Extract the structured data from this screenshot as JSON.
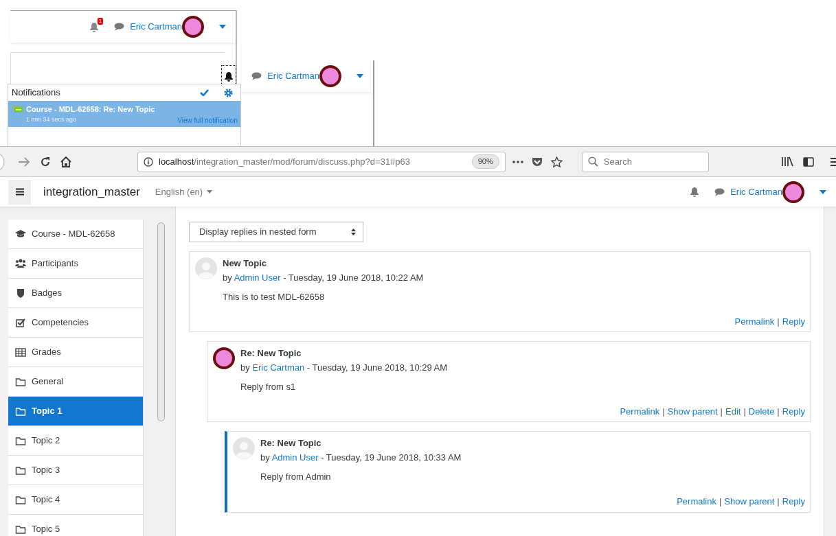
{
  "header_snippet": {
    "notification_count": "1",
    "user_name": "Eric Cartman"
  },
  "header_snippet_focused": {
    "user_name": "Eric Cartman",
    "bell_focused": true
  },
  "notifications_popover": {
    "title": "Notifications",
    "items": [
      {
        "title": "Course - MDL-62658: Re: New Topic",
        "time": "1 min 34 secs ago",
        "link": "View full notification",
        "selected": true
      }
    ]
  },
  "browser": {
    "url_host": "localhost",
    "url_path": "/integration_master/mod/forum/discuss.php?d=31#p63",
    "zoom": "90%",
    "search_placeholder": "Search"
  },
  "navbar": {
    "site_name": "integration_master",
    "language": "English (en)",
    "user_name": "Eric Cartman"
  },
  "drawer": {
    "items": [
      {
        "label": "Course - MDL-62658",
        "kind": "course",
        "selected": false
      },
      {
        "label": "Participants",
        "kind": "participants",
        "selected": false
      },
      {
        "label": "Badges",
        "kind": "badges",
        "selected": false
      },
      {
        "label": "Competencies",
        "kind": "competencies",
        "selected": false
      },
      {
        "label": "Grades",
        "kind": "grades",
        "selected": false
      },
      {
        "label": "General",
        "kind": "section",
        "selected": false
      },
      {
        "label": "Topic 1",
        "kind": "section",
        "selected": true
      },
      {
        "label": "Topic 2",
        "kind": "section",
        "selected": false
      },
      {
        "label": "Topic 3",
        "kind": "section",
        "selected": false
      },
      {
        "label": "Topic 4",
        "kind": "section",
        "selected": false
      },
      {
        "label": "Topic 5",
        "kind": "section",
        "selected": false
      }
    ]
  },
  "discussion": {
    "display_mode": "Display replies in nested form",
    "separator": "|",
    "posts": [
      {
        "subject": "New Topic",
        "by": "by",
        "author": "Admin User",
        "date": "- Tuesday, 19 June 2018, 10:22 AM",
        "message": "This is to test MDL-62658",
        "kind": "plain",
        "highlighted": false,
        "actions": [
          "Permalink",
          "Reply"
        ],
        "children": [
          {
            "subject": "Re: New Topic",
            "by": "by",
            "author": "Eric Cartman",
            "date": "- Tuesday, 19 June 2018, 10:29 AM",
            "message": "Reply from s1",
            "kind": "picture",
            "highlighted": false,
            "actions": [
              "Permalink",
              "Show parent",
              "Edit",
              "Delete",
              "Reply"
            ],
            "children": [
              {
                "subject": "Re: New Topic",
                "by": "by",
                "author": "Admin User",
                "date": "- Tuesday, 19 June 2018, 10:33 AM",
                "message": "Reply from Admin",
                "kind": "plain",
                "highlighted": true,
                "actions": [
                  "Permalink",
                  "Show parent",
                  "Reply"
                ]
              }
            ]
          }
        ]
      }
    ]
  }
}
